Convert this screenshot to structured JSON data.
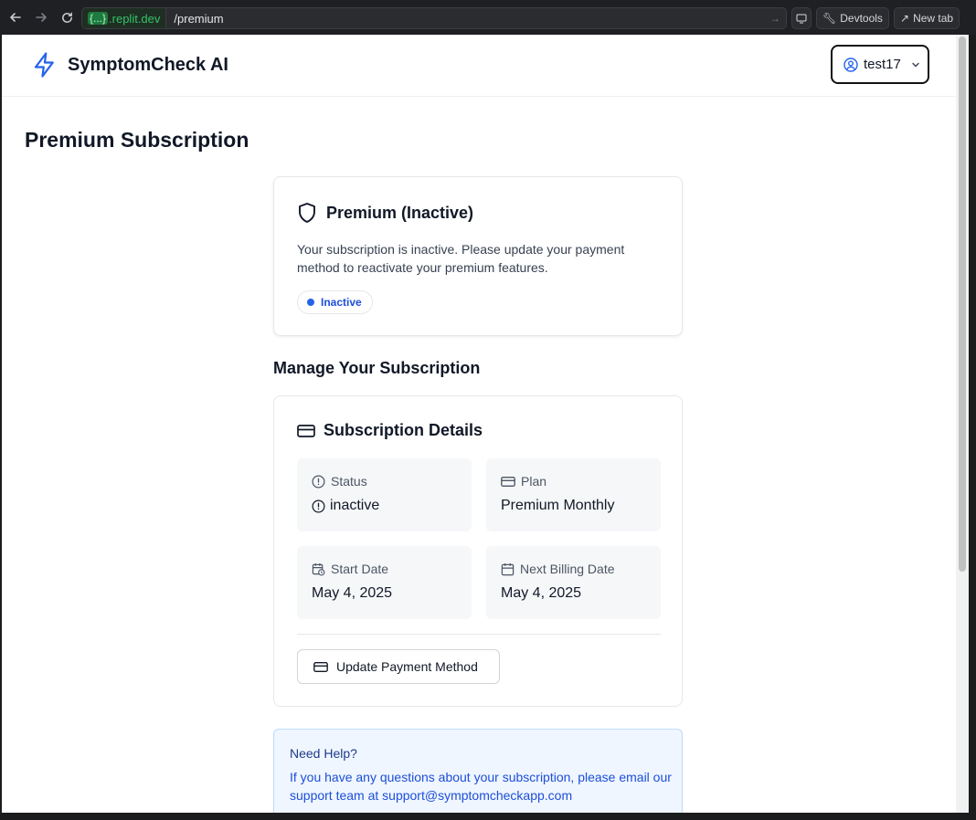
{
  "browser": {
    "url_host": ".replit.dev",
    "url_braces": "{...}",
    "url_path": "/premium",
    "devtools_label": "Devtools",
    "new_tab_label": "New tab"
  },
  "header": {
    "app_name": "SymptomCheck AI",
    "username": "test17"
  },
  "page": {
    "title": "Premium Subscription"
  },
  "status_card": {
    "title": "Premium (Inactive)",
    "description": "Your subscription is inactive. Please update your payment method to reactivate your premium features.",
    "badge": "Inactive"
  },
  "manage": {
    "section_title": "Manage Your Subscription",
    "card_title": "Subscription Details",
    "status_label": "Status",
    "status_value": "inactive",
    "plan_label": "Plan",
    "plan_value": "Premium Monthly",
    "start_label": "Start Date",
    "start_value": "May 4, 2025",
    "next_label": "Next Billing Date",
    "next_value": "May 4, 2025",
    "update_button": "Update Payment Method"
  },
  "help": {
    "title": "Need Help?",
    "text": "If you have any questions about your subscription, please email our support team at support@symptomcheckapp.com"
  },
  "colors": {
    "accent": "#2563eb",
    "help_bg": "#eff6ff"
  }
}
